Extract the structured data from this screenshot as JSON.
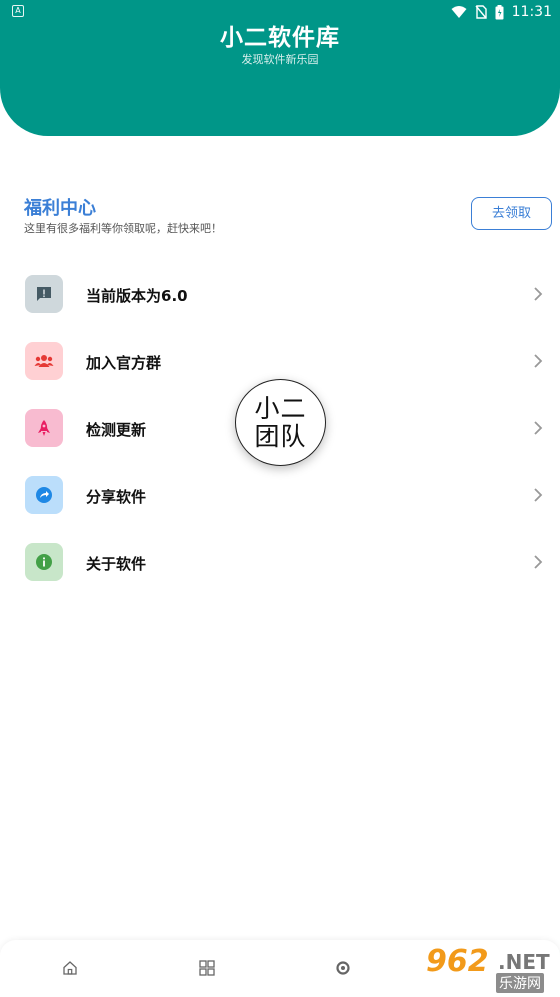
{
  "status_bar": {
    "left_indicator": "A",
    "time": "11:31"
  },
  "header": {
    "title": "小二软件库",
    "subtitle": "发现软件新乐园",
    "background_color": "#009688"
  },
  "welfare": {
    "title": "福利中心",
    "description": "这里有很多福利等你领取呢，赶快来吧！",
    "button_label": "去领取",
    "accent_color": "#3b7fd6"
  },
  "menu": {
    "items": [
      {
        "label": "当前版本为6.0",
        "icon": "feedback-icon",
        "icon_bg": "#cfd8dc",
        "icon_color": "#455a64"
      },
      {
        "label": "加入官方群",
        "icon": "group-icon",
        "icon_bg": "#ffd0d3",
        "icon_color": "#e53935"
      },
      {
        "label": "检测更新",
        "icon": "rocket-icon",
        "icon_bg": "#f8bbd0",
        "icon_color": "#e91e63"
      },
      {
        "label": "分享软件",
        "icon": "share-icon",
        "icon_bg": "#bbdefb",
        "icon_color": "#1e88e5"
      },
      {
        "label": "关于软件",
        "icon": "info-icon",
        "icon_bg": "#c8e6c9",
        "icon_color": "#43a047"
      }
    ]
  },
  "badge": {
    "line1": "小二",
    "line2": "团队"
  },
  "bottom_nav": {
    "tabs": [
      "home-icon",
      "grid-icon",
      "discover-icon"
    ]
  },
  "watermark": {
    "number": "962",
    "suffix": ".NET",
    "site": "乐游网"
  }
}
